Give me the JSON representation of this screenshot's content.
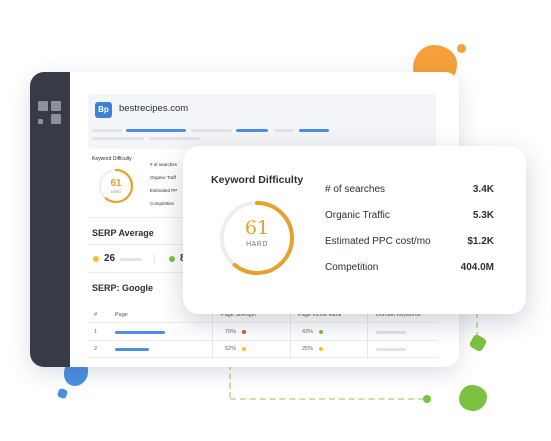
{
  "header": {
    "logo_text": "Bp",
    "domain": "bestrecipes.com"
  },
  "mini_panel": {
    "title": "Keyword Difficulty",
    "score": "61",
    "level": "HARD",
    "metric_labels": [
      "# of searches",
      "Organic Traff",
      "Estimated PP",
      "Competition"
    ]
  },
  "serp_average": {
    "title": "SERP Average",
    "value_1": "26",
    "value_2": "8"
  },
  "serp_google": {
    "title": "SERP: Google",
    "columns": [
      "#",
      "Page",
      "Page Strength",
      "Page InLink Rank",
      "Domain Keywords"
    ],
    "rows": [
      {
        "index": "1",
        "strength": "70%",
        "inlink": "43%",
        "strength_color": "#e84c3d",
        "inlink_color": "#7cc242"
      },
      {
        "index": "2",
        "strength": "52%",
        "inlink": "25%",
        "strength_color": "#f2c12e",
        "inlink_color": "#f2c12e"
      }
    ]
  },
  "kd_card": {
    "title": "Keyword Difficulty",
    "score": "61",
    "score_fraction": 0.61,
    "level": "HARD",
    "metrics": [
      {
        "label": "# of searches",
        "value": "3.4K"
      },
      {
        "label": "Organic Traffic",
        "value": "5.3K"
      },
      {
        "label": "Estimated PPC cost/mo",
        "value": "$1.2K"
      },
      {
        "label": "Competition",
        "value": "404.0M"
      }
    ]
  },
  "colors": {
    "accent": "#e6a12e",
    "ring_track": "#eeeeee",
    "link_blue": "#4a90e2",
    "sidebar": "#363b47"
  }
}
